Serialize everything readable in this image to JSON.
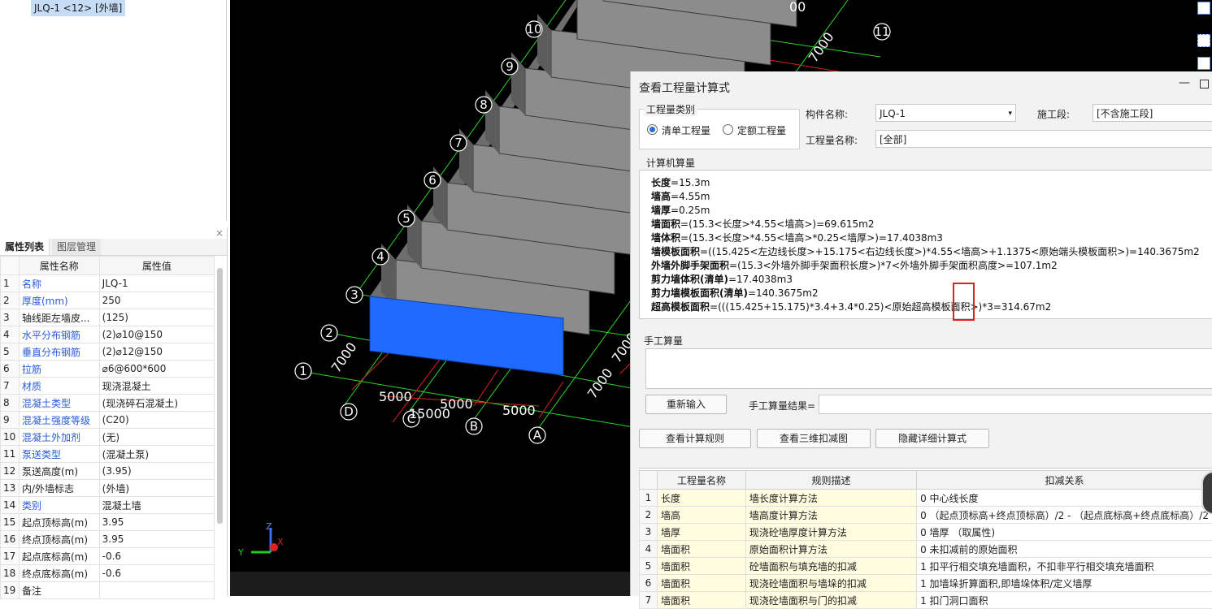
{
  "tree": {
    "selected_item": "JLQ-1 <12> [外墙]"
  },
  "property_panel": {
    "close_glyph": "×",
    "tabs": [
      "属性列表",
      "图层管理"
    ],
    "headers": [
      "属性名称",
      "属性值"
    ],
    "rows": [
      {
        "n": "1",
        "name": "名称",
        "value": "JLQ-1",
        "blue": true
      },
      {
        "n": "2",
        "name": "厚度(mm)",
        "value": "250",
        "blue": true
      },
      {
        "n": "3",
        "name": "轴线距左墙皮...",
        "value": "(125)",
        "blue": false
      },
      {
        "n": "4",
        "name": "水平分布钢筋",
        "value": "(2)⌀10@150",
        "blue": true
      },
      {
        "n": "5",
        "name": "垂直分布钢筋",
        "value": "(2)⌀12@150",
        "blue": true
      },
      {
        "n": "6",
        "name": "拉筋",
        "value": "⌀6@600*600",
        "blue": true
      },
      {
        "n": "7",
        "name": "材质",
        "value": "现浇混凝土",
        "blue": true
      },
      {
        "n": "8",
        "name": "混凝土类型",
        "value": "(现浇碎石混凝土)",
        "blue": true
      },
      {
        "n": "9",
        "name": "混凝土强度等级",
        "value": "(C20)",
        "blue": true
      },
      {
        "n": "10",
        "name": "混凝土外加剂",
        "value": "(无)",
        "blue": true
      },
      {
        "n": "11",
        "name": "泵送类型",
        "value": "(混凝土泵)",
        "blue": true
      },
      {
        "n": "12",
        "name": "泵送高度(m)",
        "value": "(3.95)",
        "blue": false
      },
      {
        "n": "13",
        "name": "内/外墙标志",
        "value": "(外墙)",
        "blue": false
      },
      {
        "n": "14",
        "name": "类别",
        "value": "混凝土墙",
        "blue": true
      },
      {
        "n": "15",
        "name": "起点顶标高(m)",
        "value": "3.95",
        "blue": false
      },
      {
        "n": "16",
        "name": "终点顶标高(m)",
        "value": "3.95",
        "blue": false
      },
      {
        "n": "17",
        "name": "起点底标高(m)",
        "value": "-0.6",
        "blue": false
      },
      {
        "n": "18",
        "name": "终点底标高(m)",
        "value": "-0.6",
        "blue": false
      },
      {
        "n": "19",
        "name": "备注",
        "value": "",
        "blue": false
      }
    ]
  },
  "viewport": {
    "axis_labels_numbers": [
      "1",
      "2",
      "3",
      "4",
      "5",
      "6",
      "7",
      "8",
      "9",
      "10",
      "11"
    ],
    "axis_labels_letters": [
      "A",
      "B",
      "C",
      "D"
    ],
    "dimensions": [
      "5000",
      "5000",
      "15000",
      "5000",
      "7000",
      "7000",
      "7000",
      "7000",
      "00"
    ],
    "axis_indicator": {
      "x": "X",
      "y": "Y",
      "z": "Z"
    },
    "wall_highlight_color": "#1f6bff",
    "wall_color": "#8c8c8c",
    "grid_color": "#2bd42b",
    "dim_color": "#e02020"
  },
  "dialog": {
    "title": "查看工程量计算式",
    "min_glyph": "—",
    "type_group": {
      "label": "工程量类别",
      "options": [
        "清单工程量",
        "定额工程量"
      ],
      "selected": "清单工程量"
    },
    "component_name_label": "构件名称:",
    "component_name_value": "JLQ-1",
    "stage_label": "施工段:",
    "stage_value": "[不含施工段]",
    "quantity_name_label": "工程量名称:",
    "quantity_name_value": "[全部]",
    "calc_label": "计算机算量",
    "calc_lines": [
      {
        "k": "长度",
        "v": "=15.3m"
      },
      {
        "k": "墙高",
        "v": "=4.55m"
      },
      {
        "k": "墙厚",
        "v": "=0.25m"
      },
      {
        "k": "墙面积",
        "v": "=(15.3<长度>*4.55<墙高>)=69.615m2"
      },
      {
        "k": "墙体积",
        "v": "=(15.3<长度>*4.55<墙高>*0.25<墙厚>)=17.4038m3"
      },
      {
        "k": "墙模板面积",
        "v": "=((15.425<左边线长度>+15.175<右边线长度>)*4.55<墙高>+1.1375<原始端头模板面积>)=140.3675m2"
      },
      {
        "k": "外墙外脚手架面积",
        "v": "=(15.3<外墙外脚手架面积长度>)*7<外墙外脚手架面积高度>=107.1m2"
      },
      {
        "k": "剪力墙体积(清单)",
        "v": "=17.4038m3"
      },
      {
        "k": "剪力墙模板面积(清单)",
        "v": "=140.3675m2"
      },
      {
        "k": "超高模板面积",
        "v": "=(((15.425+15.175)*3.4+3.4*0.25)<原始超高模板面积>)*3=314.67m2"
      }
    ],
    "manual_label": "手工算量",
    "reenter_button": "重新输入",
    "manual_result_label": "手工算量结果=",
    "buttons": [
      "查看计算规则",
      "查看三维扣减图",
      "隐藏详细计算式"
    ],
    "rules_headers": [
      "工程量名称",
      "规则描述",
      "扣减关系"
    ],
    "rules_rows": [
      {
        "n": "1",
        "name": "长度",
        "desc": "墙长度计算方法",
        "rel": "0  中心线长度"
      },
      {
        "n": "2",
        "name": "墙高",
        "desc": "墙高度计算方法",
        "rel": "0  （起点顶标高+终点顶标高）/2 - （起点底标高+终点底标高）/2"
      },
      {
        "n": "3",
        "name": "墙厚",
        "desc": "现浇砼墙厚度计算方法",
        "rel": "0  墙厚 （取属性)"
      },
      {
        "n": "4",
        "name": "墙面积",
        "desc": "原始面积计算方法",
        "rel": "0 未扣减前的原始面积"
      },
      {
        "n": "5",
        "name": "墙面积",
        "desc": "砼墙面积与填充墙的扣减",
        "rel": "1 扣平行相交填充墙面积，不扣非平行相交填充墙面积"
      },
      {
        "n": "6",
        "name": "墙面积",
        "desc": "现浇砼墙面积与墙垛的扣减",
        "rel": "1  加墙垛折算面积,即墙垛体积/定义墙厚"
      },
      {
        "n": "7",
        "name": "墙面积",
        "desc": "现浇砼墙面积与门的扣减",
        "rel": "1  扣门洞口面积"
      }
    ]
  }
}
